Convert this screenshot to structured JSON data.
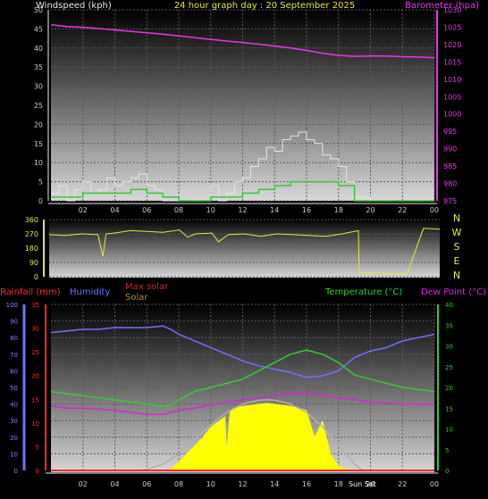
{
  "colors": {
    "background": "#000000",
    "windspeed": "#e6e6e6",
    "wind_avg": "#33cc33",
    "barometer": "#ee33ee",
    "wind_dir": "#e8e83a",
    "rainfall": "#ff2a2a",
    "humidity": "#7070ff",
    "temperature": "#33cc33",
    "dew_point": "#dd22dd",
    "solar_fill": "#ffff00",
    "max_solar": "#b0b0b0",
    "grid": "#5a5a5a",
    "title": "#e8e83a"
  },
  "chart_data": [
    {
      "type": "line",
      "panel": "wind-barometer",
      "title": "24 hour graph day : 20 September 2025",
      "x_ticks": [
        "02",
        "04",
        "06",
        "08",
        "10",
        "12",
        "14",
        "16",
        "18",
        "20",
        "22",
        "00"
      ],
      "x_range_hours": [
        0,
        24
      ],
      "grid": true,
      "left_axis": {
        "label": "Windspeed (kph)",
        "range": [
          0,
          50
        ],
        "ticks": [
          "0",
          "5",
          "10",
          "15",
          "20",
          "25",
          "30",
          "35",
          "40",
          "45",
          "50"
        ]
      },
      "right_axis": {
        "label": "Barometer (hpa)",
        "range": [
          975,
          1030
        ],
        "ticks": [
          "975",
          "980",
          "985",
          "990",
          "995",
          "1000",
          "1005",
          "1010",
          "1015",
          "1020",
          "1025",
          "1030"
        ]
      },
      "series": [
        {
          "axis": "right",
          "x": [
            0,
            1,
            2,
            3,
            4,
            5,
            6,
            7,
            8,
            9,
            10,
            11,
            12,
            13,
            14,
            15,
            16,
            17,
            18,
            19,
            20,
            21,
            22,
            23,
            24
          ],
          "values": [
            1025.7,
            1025.2,
            1025.0,
            1024.6,
            1024.2,
            1023.8,
            1023.4,
            1023.0,
            1022.5,
            1022.0,
            1021.5,
            1021.0,
            1020.6,
            1020.1,
            1019.6,
            1019.0,
            1018.3,
            1017.5,
            1016.9,
            1016.6,
            1016.7,
            1016.7,
            1016.5,
            1016.4,
            1016.2
          ]
        },
        {
          "axis": "left",
          "x": [
            0,
            0.5,
            1,
            1.5,
            2,
            2.5,
            3,
            3.5,
            4,
            4.5,
            5,
            5.5,
            6,
            6.5,
            7,
            7.5,
            8,
            8.5,
            9,
            9.5,
            10,
            10.5,
            11,
            11.5,
            12,
            12.5,
            13,
            13.5,
            14,
            14.5,
            15,
            15.5,
            16,
            16.5,
            17,
            17.5,
            18,
            18.5,
            19,
            20,
            21,
            22,
            23,
            24
          ],
          "values": [
            2,
            4,
            0,
            3,
            5,
            2,
            3,
            6,
            4,
            5,
            6,
            7,
            4,
            3,
            0,
            0,
            0,
            0,
            0,
            0,
            4,
            0,
            2,
            5,
            6,
            9,
            11,
            14,
            13,
            16,
            17,
            18,
            16,
            15,
            12,
            11,
            9,
            5,
            1,
            0,
            0,
            0,
            0,
            0
          ]
        },
        {
          "axis": "left",
          "x": [
            0,
            1,
            2,
            3,
            4,
            5,
            6,
            7,
            8,
            9,
            10,
            11,
            12,
            13,
            14,
            15,
            16,
            17,
            18,
            19,
            20,
            21,
            22,
            23,
            24
          ],
          "values": [
            1,
            1,
            2,
            2,
            2,
            3,
            2,
            1,
            0,
            0,
            1,
            1,
            2,
            3,
            4,
            5,
            5,
            5,
            4,
            0,
            0,
            0,
            0,
            0,
            0
          ]
        }
      ]
    },
    {
      "type": "scatter",
      "panel": "wind-direction",
      "y_ticks": [
        "0",
        "90",
        "180",
        "270",
        "360"
      ],
      "y_range": [
        0,
        360
      ],
      "compass_labels": [
        "N",
        "W",
        "S",
        "E",
        "N"
      ],
      "grid": true,
      "series": [
        {
          "x": [
            0,
            1,
            2,
            3,
            3.3,
            3.5,
            4,
            5,
            6,
            7,
            8,
            8.5,
            9,
            10,
            10.4,
            11,
            12,
            13,
            14,
            15,
            16,
            17,
            18,
            19,
            19.05,
            20,
            21,
            22,
            23,
            24
          ],
          "values": [
            265,
            260,
            270,
            265,
            130,
            270,
            275,
            290,
            285,
            280,
            295,
            250,
            270,
            275,
            220,
            265,
            270,
            255,
            270,
            265,
            260,
            255,
            270,
            290,
            25,
            25,
            20,
            20,
            305,
            300
          ]
        }
      ]
    },
    {
      "type": "line",
      "panel": "temp-humidity-solar",
      "legend": [
        "Rainfall (mm)",
        "Humidity",
        "Max solar",
        "Solar",
        "Temperature (°C)",
        "Dew Point (°C)"
      ],
      "sun_label": "Sun Set",
      "x_ticks": [
        "02",
        "04",
        "06",
        "08",
        "10",
        "12",
        "14",
        "16",
        "18",
        "20",
        "22",
        "00"
      ],
      "x_range_hours": [
        0,
        24
      ],
      "grid": true,
      "humidity_axis": {
        "range": [
          0,
          100
        ],
        "ticks": [
          "0",
          "10",
          "20",
          "30",
          "40",
          "50",
          "60",
          "70",
          "80",
          "90",
          "100"
        ]
      },
      "rain_axis": {
        "range": [
          0,
          35
        ],
        "ticks": [
          "0",
          "5",
          "10",
          "15",
          "20",
          "25",
          "30",
          "35"
        ]
      },
      "temp_axis": {
        "range": [
          0,
          40
        ],
        "ticks": [
          "0",
          "5",
          "10",
          "15",
          "20",
          "25",
          "30",
          "35",
          "40"
        ]
      },
      "series": [
        {
          "name": "Humidity",
          "axis": "humidity",
          "x": [
            0,
            1,
            2,
            3,
            4,
            5,
            6,
            7,
            7.5,
            8,
            9,
            10,
            11,
            12,
            13,
            14,
            15,
            16,
            17,
            18,
            19,
            20,
            21,
            22,
            23,
            24
          ],
          "values": [
            83,
            84,
            85,
            85,
            86,
            86,
            86,
            87,
            85,
            82,
            78,
            74,
            70,
            66,
            63,
            61,
            59,
            56,
            57,
            60,
            68,
            72,
            74,
            78,
            80,
            82
          ]
        },
        {
          "name": "Temperature (°C)",
          "axis": "temp",
          "x": [
            0,
            1,
            2,
            3,
            4,
            5,
            6,
            7,
            7.5,
            8,
            9,
            10,
            11,
            12,
            13,
            14,
            15,
            16,
            17,
            18,
            19,
            20,
            21,
            22,
            23,
            24
          ],
          "values": [
            19,
            18.5,
            18,
            17.5,
            17,
            16.5,
            16,
            15.5,
            15.8,
            17,
            19,
            20,
            21,
            22,
            24,
            26,
            28,
            29,
            28,
            26,
            23,
            22,
            21,
            20,
            19.5,
            19
          ]
        },
        {
          "name": "Dew Point (°C)",
          "axis": "temp",
          "x": [
            0,
            1,
            2,
            3,
            4,
            5,
            6,
            7,
            8,
            9,
            10,
            11,
            12,
            13,
            14,
            15,
            16,
            17,
            18,
            19,
            20,
            21,
            22,
            23,
            24
          ],
          "values": [
            15.5,
            15,
            15,
            14.8,
            14.5,
            14,
            13.5,
            13.5,
            14.5,
            15,
            15.8,
            16.5,
            17,
            17.5,
            18,
            18.5,
            18.8,
            18,
            17.5,
            17,
            16.5,
            16.3,
            16,
            16,
            15.8
          ]
        },
        {
          "name": "Solar",
          "axis": "temp",
          "x": [
            5.6,
            6,
            7,
            7.5,
            8,
            9,
            9.5,
            10,
            10.9,
            11,
            11.2,
            11.4,
            12,
            13,
            13.5,
            14,
            15,
            15.5,
            16,
            16.5,
            17,
            17.5,
            18,
            18.5,
            19,
            19.5
          ],
          "values": [
            0,
            0,
            0,
            0.3,
            2,
            6,
            8,
            10.5,
            13,
            5,
            14,
            15,
            15.5,
            16,
            16.2,
            16,
            15.5,
            15,
            14.5,
            8,
            12,
            4,
            1,
            0.3,
            0,
            0
          ]
        },
        {
          "name": "Max solar",
          "axis": "temp",
          "x": [
            5.6,
            6,
            7,
            8,
            9,
            10,
            11,
            12,
            13,
            13.5,
            14,
            15,
            16,
            17,
            18,
            19,
            19.5
          ],
          "values": [
            0,
            0.3,
            1.5,
            4,
            7.5,
            11,
            14,
            16,
            16.9,
            17,
            16.9,
            16,
            14,
            10.5,
            6,
            1.5,
            0
          ]
        },
        {
          "name": "Rainfall (mm)",
          "axis": "rain",
          "x": [
            0,
            24
          ],
          "values": [
            0,
            0
          ]
        }
      ]
    }
  ]
}
